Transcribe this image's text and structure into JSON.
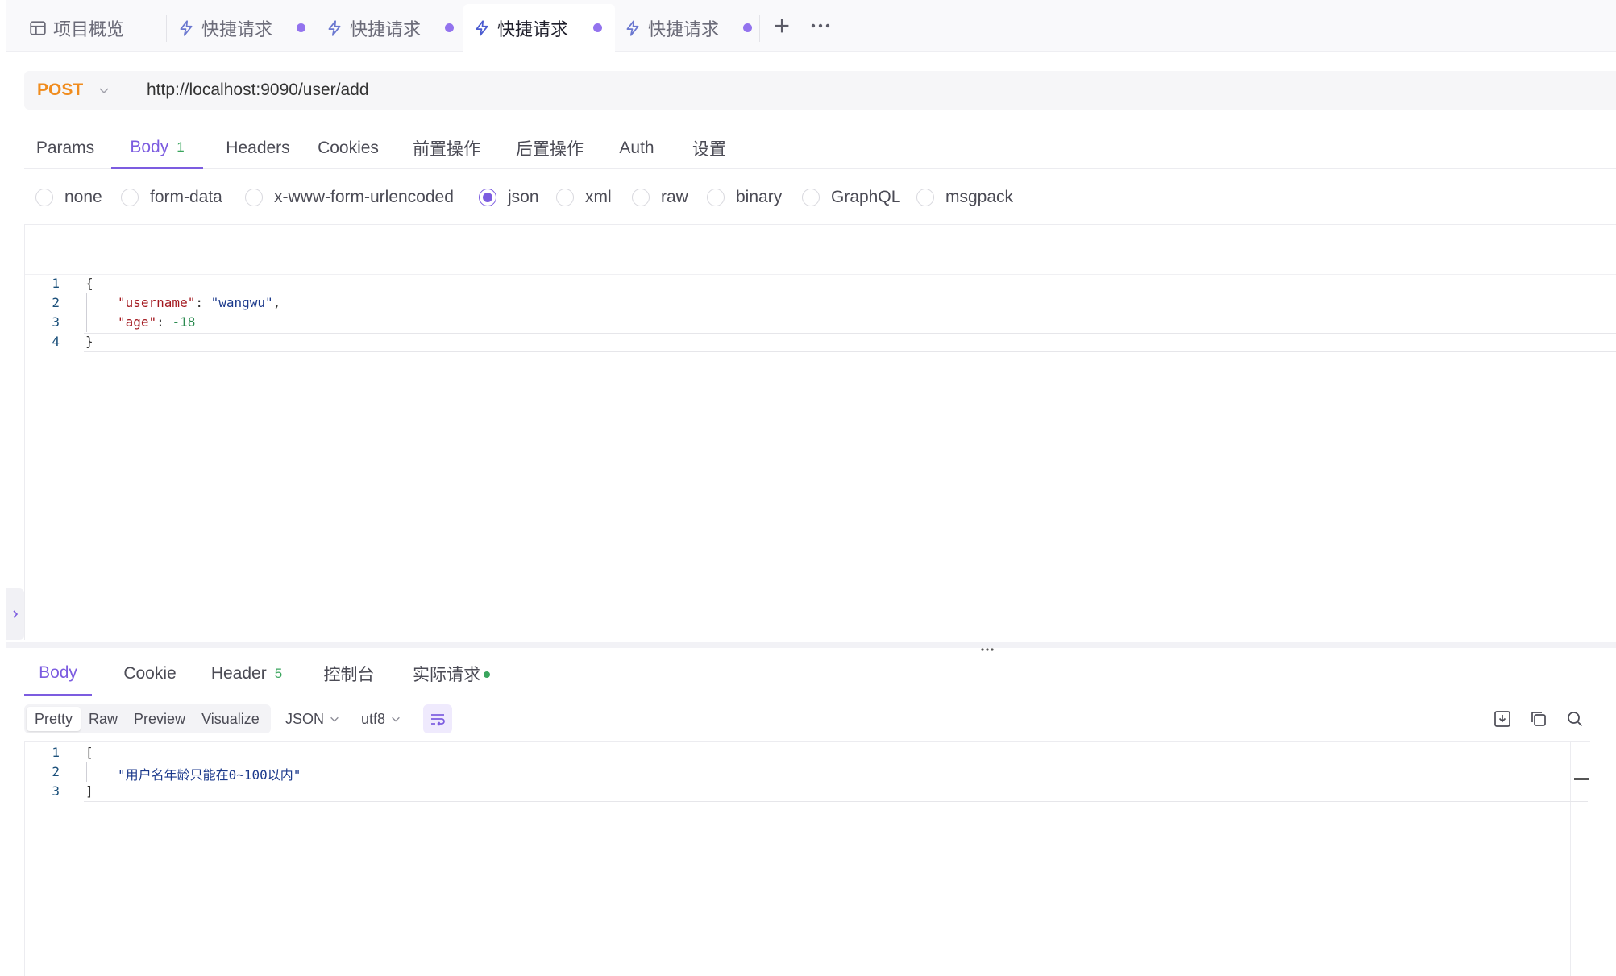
{
  "tabs": [
    {
      "label": "项目概览",
      "icon": "overview-icon",
      "active": false,
      "dot": false
    },
    {
      "label": "快捷请求",
      "icon": "lightning-icon",
      "active": false,
      "dot": true
    },
    {
      "label": "快捷请求",
      "icon": "lightning-icon",
      "active": false,
      "dot": true
    },
    {
      "label": "快捷请求",
      "icon": "lightning-icon",
      "active": true,
      "dot": true
    },
    {
      "label": "快捷请求",
      "icon": "lightning-icon",
      "active": false,
      "dot": true
    }
  ],
  "request": {
    "method": "POST",
    "url": "http://localhost:9090/user/add"
  },
  "request_tabs": [
    {
      "label": "Params"
    },
    {
      "label": "Body",
      "badge": "1",
      "active": true
    },
    {
      "label": "Headers"
    },
    {
      "label": "Cookies"
    },
    {
      "label": "前置操作"
    },
    {
      "label": "后置操作"
    },
    {
      "label": "Auth"
    },
    {
      "label": "设置"
    }
  ],
  "body_types": [
    {
      "label": "none"
    },
    {
      "label": "form-data"
    },
    {
      "label": "x-www-form-urlencoded"
    },
    {
      "label": "json",
      "checked": true
    },
    {
      "label": "xml"
    },
    {
      "label": "raw"
    },
    {
      "label": "binary"
    },
    {
      "label": "GraphQL"
    },
    {
      "label": "msgpack"
    }
  ],
  "request_body": {
    "line_numbers": [
      "1",
      "2",
      "3",
      "4"
    ],
    "open": "{",
    "close": "}",
    "key1": "\"username\"",
    "val1": "\"wangwu\"",
    "key2": "\"age\"",
    "val2": "-18"
  },
  "response_tabs": [
    {
      "label": "Body",
      "active": true
    },
    {
      "label": "Cookie"
    },
    {
      "label": "Header",
      "badge": "5"
    },
    {
      "label": "控制台"
    },
    {
      "label": "实际请求",
      "dot": true
    }
  ],
  "response_toolbar": {
    "views": [
      "Pretty",
      "Raw",
      "Preview",
      "Visualize"
    ],
    "format": "JSON",
    "encoding": "utf8"
  },
  "response_body": {
    "line_numbers": [
      "1",
      "2",
      "3"
    ],
    "open": "[",
    "close": "]",
    "message": "\"用户名年龄只能在0~100以内\""
  },
  "colors": {
    "accent": "#7c5ce0",
    "method_post": "#f08c1e",
    "badge_green": "#3aa55d"
  }
}
